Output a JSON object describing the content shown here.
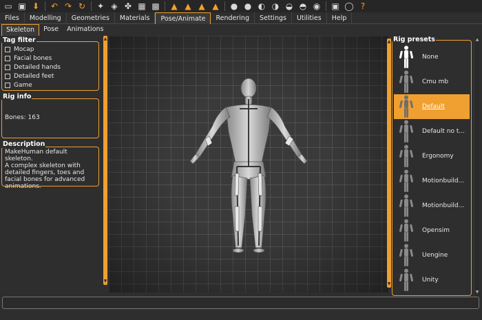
{
  "toolbar": {
    "icons": [
      "undo-icon",
      "redo-icon",
      "reset-icon"
    ]
  },
  "main_tabs": [
    {
      "label": "Files"
    },
    {
      "label": "Modelling"
    },
    {
      "label": "Geometries"
    },
    {
      "label": "Materials"
    },
    {
      "label": "Pose/Animate"
    },
    {
      "label": "Rendering"
    },
    {
      "label": "Settings"
    },
    {
      "label": "Utilities"
    },
    {
      "label": "Help"
    }
  ],
  "sub_tabs": [
    {
      "label": "Skeleton"
    },
    {
      "label": "Pose"
    },
    {
      "label": "Animations"
    }
  ],
  "tag_filter": {
    "title": "Tag filter",
    "items": [
      "Mocap",
      "Facial bones",
      "Detailed hands",
      "Detailed feet",
      "Game"
    ]
  },
  "rig_info": {
    "title": "Rig info",
    "bones_text": "Bones: 163"
  },
  "description": {
    "title": "Description",
    "lines": [
      "MakeHuman default skeleton.",
      "A complex skeleton with",
      "detailed fingers, toes and",
      "facial bones for advanced",
      "animations."
    ]
  },
  "rig_presets": {
    "title": "Rig presets",
    "items": [
      "None",
      "Cmu mb",
      "Default",
      "Default no t...",
      "Ergonomy",
      "Motionbuild...",
      "Motionbuild...",
      "Opensim",
      "Uengine",
      "Unity"
    ],
    "selected": "Default"
  },
  "colors": {
    "accent": "#f0a030",
    "background": "#2e2e2e",
    "viewport_bg": "#3a3a3a",
    "text": "#e8e8e8"
  }
}
